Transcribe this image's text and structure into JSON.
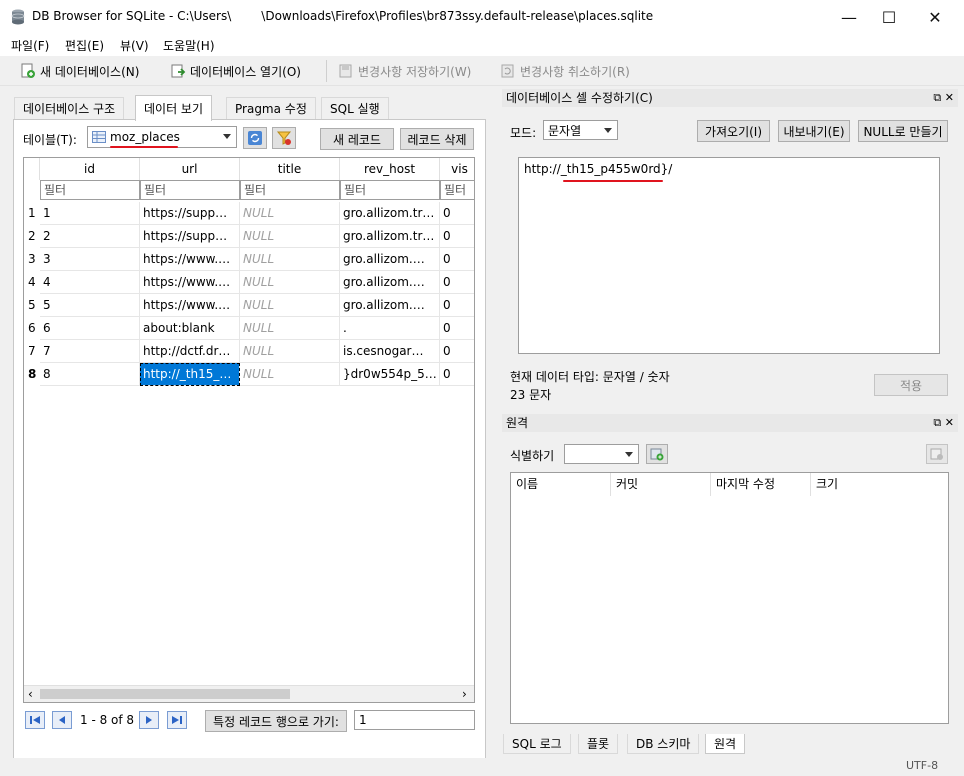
{
  "window": {
    "title": "DB Browser for SQLite - C:\\Users\\",
    "title_path": "\\Downloads\\Firefox\\Profiles\\br873ssy.default-release\\places.sqlite",
    "minimize": "—",
    "maximize": "☐",
    "close": "✕"
  },
  "menu": [
    "파일(F)",
    "편집(E)",
    "뷰(V)",
    "도움말(H)"
  ],
  "toolbar": {
    "new_db": "새 데이터베이스(N)",
    "open_db": "데이터베이스 열기(O)",
    "write_changes": "변경사항 저장하기(W)",
    "revert_changes": "변경사항 취소하기(R)"
  },
  "tabs": [
    "데이터베이스 구조",
    "데이터 보기",
    "Pragma 수정",
    "SQL 실행"
  ],
  "browse": {
    "table_label": "테이블(T):",
    "table_value": "moz_places",
    "new_record": "새 레코드",
    "delete_record": "레코드 삭제",
    "filter_placeholder": "필터",
    "columns": [
      "id",
      "url",
      "title",
      "rev_host",
      "vis"
    ],
    "rows": [
      {
        "n": "1",
        "id": "1",
        "url": "https://supp…",
        "title": "NULL",
        "rev_host": "gro.allizom.tr…",
        "vis": "0"
      },
      {
        "n": "2",
        "id": "2",
        "url": "https://supp…",
        "title": "NULL",
        "rev_host": "gro.allizom.tr…",
        "vis": "0"
      },
      {
        "n": "3",
        "id": "3",
        "url": "https://www.…",
        "title": "NULL",
        "rev_host": "gro.allizom.…",
        "vis": "0"
      },
      {
        "n": "4",
        "id": "4",
        "url": "https://www.…",
        "title": "NULL",
        "rev_host": "gro.allizom.…",
        "vis": "0"
      },
      {
        "n": "5",
        "id": "5",
        "url": "https://www.…",
        "title": "NULL",
        "rev_host": "gro.allizom.…",
        "vis": "0"
      },
      {
        "n": "6",
        "id": "6",
        "url": "about:blank",
        "title": "NULL",
        "rev_host": ".",
        "vis": "0"
      },
      {
        "n": "7",
        "id": "7",
        "url": "http://dctf.dr…",
        "title": "NULL",
        "rev_host": "is.cesnogar…",
        "vis": "0"
      },
      {
        "n": "8",
        "id": "8",
        "url": "http://_th15_…",
        "title": "NULL",
        "rev_host": "}dr0w554p_5…",
        "vis": "0"
      }
    ],
    "nav_status": "1 - 8 of 8",
    "goto_label": "특정 레코드 행으로 가기:",
    "goto_value": "1"
  },
  "cell_editor": {
    "header": "데이터베이스 셀 수정하기(C)",
    "mode_label": "모드:",
    "mode_value": "문자열",
    "import": "가져오기(I)",
    "export": "내보내기(E)",
    "set_null": "NULL로 만들기",
    "content": "http://_th15_p455w0rd}/",
    "type_info": "현재 데이터 타입: 문자열 / 숫자",
    "size_info": "23 문자",
    "apply": "적용"
  },
  "remote": {
    "header": "원격",
    "identity_label": "식별하기",
    "columns": [
      "이름",
      "커밋",
      "마지막 수정",
      "크기"
    ]
  },
  "bottom_tabs": [
    "SQL 로그",
    "플롯",
    "DB 스키마",
    "원격"
  ],
  "status": {
    "encoding": "UTF-8"
  },
  "colors": {
    "selection": "#0078d7",
    "annotation_red": "#e0141e"
  }
}
